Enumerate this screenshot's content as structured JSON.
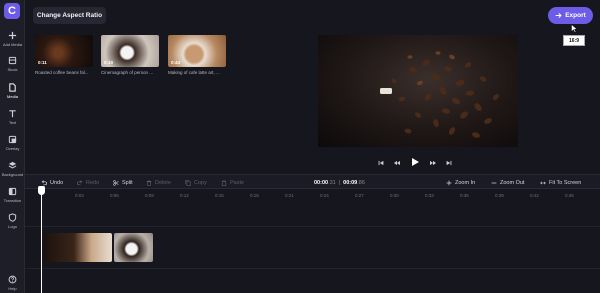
{
  "app": {
    "logo_letter": "C"
  },
  "rail": {
    "items": [
      {
        "label": "Add Media",
        "icon": "plus-icon"
      },
      {
        "label": "Stock",
        "icon": "stock-icon"
      },
      {
        "label": "Media",
        "icon": "file-icon"
      },
      {
        "label": "Text",
        "icon": "text-icon"
      },
      {
        "label": "Overlay",
        "icon": "overlay-icon"
      },
      {
        "label": "Background",
        "icon": "layers-icon"
      },
      {
        "label": "Transition",
        "icon": "transition-icon"
      },
      {
        "label": "Logo",
        "icon": "shield-icon"
      },
      {
        "label": "Help",
        "icon": "help-icon"
      }
    ]
  },
  "header": {
    "aspect_button": "Change Aspect Ratio",
    "export_button": "Export",
    "aspect_tooltip": "16:9"
  },
  "media": [
    {
      "duration": "0:11",
      "caption": "Roasted coffee beans fal..."
    },
    {
      "duration": "0:10",
      "caption": "Cinemagraph of person ..."
    },
    {
      "duration": "0:44",
      "caption": "Making of cafe latte art, ..."
    }
  ],
  "toolbar": {
    "undo": "Undo",
    "redo": "Redo",
    "split": "Split",
    "delete": "Delete",
    "copy": "Copy",
    "paste": "Paste",
    "zoom_in": "Zoom In",
    "zoom_out": "Zoom Out",
    "fit": "Fit To Screen",
    "time_current_main": "00:00",
    "time_current_frac": ".31",
    "time_total_main": "00:09",
    "time_total_frac": ".86"
  },
  "ruler_ticks": [
    "0:03",
    "0:06",
    "0:09",
    "0:12",
    "0:15",
    "0:18",
    "0:21",
    "0:24",
    "0:27",
    "0:30",
    "0:33",
    "0:36",
    "0:39",
    "0:42",
    "0:45"
  ],
  "colors": {
    "accent": "#6c5ce7",
    "background": "#16161f",
    "panel": "#1e1e29"
  }
}
